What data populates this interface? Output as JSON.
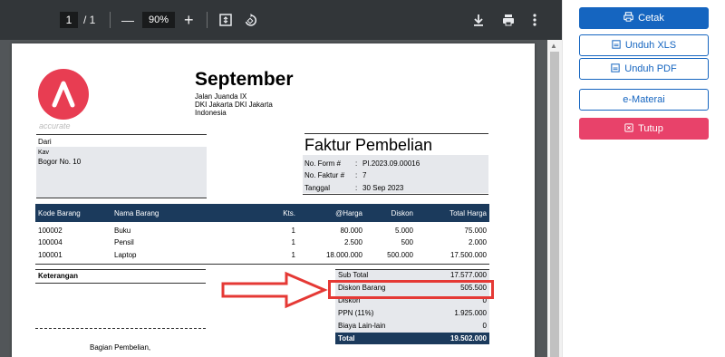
{
  "viewer": {
    "page_current": "1",
    "page_total": "/ 1",
    "zoom_minus": "—",
    "zoom_level": "90%",
    "zoom_plus": "+",
    "icons": [
      "fit-page-icon",
      "rotate-icon",
      "download-icon",
      "print-icon",
      "more-icon"
    ]
  },
  "document": {
    "logo_text": "accurate",
    "company_name": "September",
    "company_address": [
      "Jalan Juanda IX",
      "DKI Jakarta DKI Jakarta",
      "Indonesia"
    ],
    "from_label": "Dari",
    "from_name": "Kav",
    "from_address": "Bogor No. 10",
    "invoice_title": "Faktur Pembelian",
    "invoice_meta": [
      {
        "label": "No. Form #",
        "sep": ":",
        "value": "PI.2023.09.00016"
      },
      {
        "label": "No. Faktur #",
        "sep": ":",
        "value": "7"
      },
      {
        "label": "Tanggal",
        "sep": ":",
        "value": "30 Sep 2023"
      }
    ],
    "table": {
      "headers": [
        "Kode Barang",
        "Nama Barang",
        "Kts.",
        "@Harga",
        "Diskon",
        "Total Harga"
      ],
      "rows": [
        [
          "100002",
          "Buku",
          "1",
          "80.000",
          "5.000",
          "75.000"
        ],
        [
          "100004",
          "Pensil",
          "1",
          "2.500",
          "500",
          "2.000"
        ],
        [
          "100001",
          "Laptop",
          "1",
          "18.000.000",
          "500.000",
          "17.500.000"
        ]
      ]
    },
    "notes_label": "Keterangan",
    "signature_label": "Bagian Pembelian,",
    "summary": [
      {
        "label": "Sub Total",
        "value": "17.577.000"
      },
      {
        "label": "Diskon Barang",
        "value": "505.500"
      },
      {
        "label": "Diskon",
        "value": "0"
      },
      {
        "label": "PPN (11%)",
        "value": "1.925.000"
      },
      {
        "label": "Biaya Lain-lain",
        "value": "0"
      }
    ],
    "total": {
      "label": "Total",
      "value": "19.502.000"
    }
  },
  "panel": {
    "print_label": "Cetak",
    "xls_label": "Unduh XLS",
    "pdf_label": "Unduh PDF",
    "materai_label": "e-Materai",
    "close_label": "Tutup"
  },
  "colors": {
    "primary": "#1565c0",
    "danger": "#e8426a",
    "table_header": "#1b3a5c",
    "highlight": "#e53935"
  }
}
